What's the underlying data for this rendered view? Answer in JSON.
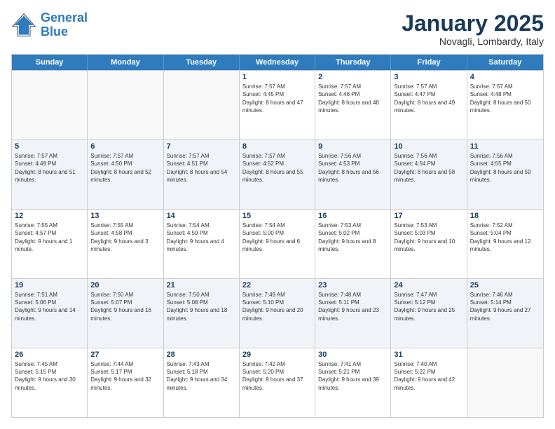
{
  "logo": {
    "line1": "General",
    "line2": "Blue"
  },
  "title": "January 2025",
  "subtitle": "Novagli, Lombardy, Italy",
  "days": [
    "Sunday",
    "Monday",
    "Tuesday",
    "Wednesday",
    "Thursday",
    "Friday",
    "Saturday"
  ],
  "weeks": [
    [
      {
        "day": "",
        "sunrise": "",
        "sunset": "",
        "daylight": ""
      },
      {
        "day": "",
        "sunrise": "",
        "sunset": "",
        "daylight": ""
      },
      {
        "day": "",
        "sunrise": "",
        "sunset": "",
        "daylight": ""
      },
      {
        "day": "1",
        "sunrise": "Sunrise: 7:57 AM",
        "sunset": "Sunset: 4:45 PM",
        "daylight": "Daylight: 8 hours and 47 minutes."
      },
      {
        "day": "2",
        "sunrise": "Sunrise: 7:57 AM",
        "sunset": "Sunset: 4:46 PM",
        "daylight": "Daylight: 8 hours and 48 minutes."
      },
      {
        "day": "3",
        "sunrise": "Sunrise: 7:57 AM",
        "sunset": "Sunset: 4:47 PM",
        "daylight": "Daylight: 8 hours and 49 minutes."
      },
      {
        "day": "4",
        "sunrise": "Sunrise: 7:57 AM",
        "sunset": "Sunset: 4:48 PM",
        "daylight": "Daylight: 8 hours and 50 minutes."
      }
    ],
    [
      {
        "day": "5",
        "sunrise": "Sunrise: 7:57 AM",
        "sunset": "Sunset: 4:49 PM",
        "daylight": "Daylight: 8 hours and 51 minutes."
      },
      {
        "day": "6",
        "sunrise": "Sunrise: 7:57 AM",
        "sunset": "Sunset: 4:50 PM",
        "daylight": "Daylight: 8 hours and 52 minutes."
      },
      {
        "day": "7",
        "sunrise": "Sunrise: 7:57 AM",
        "sunset": "Sunset: 4:51 PM",
        "daylight": "Daylight: 8 hours and 54 minutes."
      },
      {
        "day": "8",
        "sunrise": "Sunrise: 7:57 AM",
        "sunset": "Sunset: 4:52 PM",
        "daylight": "Daylight: 8 hours and 55 minutes."
      },
      {
        "day": "9",
        "sunrise": "Sunrise: 7:56 AM",
        "sunset": "Sunset: 4:53 PM",
        "daylight": "Daylight: 8 hours and 56 minutes."
      },
      {
        "day": "10",
        "sunrise": "Sunrise: 7:56 AM",
        "sunset": "Sunset: 4:54 PM",
        "daylight": "Daylight: 8 hours and 58 minutes."
      },
      {
        "day": "11",
        "sunrise": "Sunrise: 7:56 AM",
        "sunset": "Sunset: 4:55 PM",
        "daylight": "Daylight: 8 hours and 59 minutes."
      }
    ],
    [
      {
        "day": "12",
        "sunrise": "Sunrise: 7:55 AM",
        "sunset": "Sunset: 4:57 PM",
        "daylight": "Daylight: 9 hours and 1 minute."
      },
      {
        "day": "13",
        "sunrise": "Sunrise: 7:55 AM",
        "sunset": "Sunset: 4:58 PM",
        "daylight": "Daylight: 9 hours and 3 minutes."
      },
      {
        "day": "14",
        "sunrise": "Sunrise: 7:54 AM",
        "sunset": "Sunset: 4:59 PM",
        "daylight": "Daylight: 9 hours and 4 minutes."
      },
      {
        "day": "15",
        "sunrise": "Sunrise: 7:54 AM",
        "sunset": "Sunset: 5:00 PM",
        "daylight": "Daylight: 9 hours and 6 minutes."
      },
      {
        "day": "16",
        "sunrise": "Sunrise: 7:53 AM",
        "sunset": "Sunset: 5:02 PM",
        "daylight": "Daylight: 9 hours and 8 minutes."
      },
      {
        "day": "17",
        "sunrise": "Sunrise: 7:53 AM",
        "sunset": "Sunset: 5:03 PM",
        "daylight": "Daylight: 9 hours and 10 minutes."
      },
      {
        "day": "18",
        "sunrise": "Sunrise: 7:52 AM",
        "sunset": "Sunset: 5:04 PM",
        "daylight": "Daylight: 9 hours and 12 minutes."
      }
    ],
    [
      {
        "day": "19",
        "sunrise": "Sunrise: 7:51 AM",
        "sunset": "Sunset: 5:06 PM",
        "daylight": "Daylight: 9 hours and 14 minutes."
      },
      {
        "day": "20",
        "sunrise": "Sunrise: 7:50 AM",
        "sunset": "Sunset: 5:07 PM",
        "daylight": "Daylight: 9 hours and 16 minutes."
      },
      {
        "day": "21",
        "sunrise": "Sunrise: 7:50 AM",
        "sunset": "Sunset: 5:08 PM",
        "daylight": "Daylight: 9 hours and 18 minutes."
      },
      {
        "day": "22",
        "sunrise": "Sunrise: 7:49 AM",
        "sunset": "Sunset: 5:10 PM",
        "daylight": "Daylight: 9 hours and 20 minutes."
      },
      {
        "day": "23",
        "sunrise": "Sunrise: 7:48 AM",
        "sunset": "Sunset: 5:11 PM",
        "daylight": "Daylight: 9 hours and 23 minutes."
      },
      {
        "day": "24",
        "sunrise": "Sunrise: 7:47 AM",
        "sunset": "Sunset: 5:12 PM",
        "daylight": "Daylight: 9 hours and 25 minutes."
      },
      {
        "day": "25",
        "sunrise": "Sunrise: 7:46 AM",
        "sunset": "Sunset: 5:14 PM",
        "daylight": "Daylight: 9 hours and 27 minutes."
      }
    ],
    [
      {
        "day": "26",
        "sunrise": "Sunrise: 7:45 AM",
        "sunset": "Sunset: 5:15 PM",
        "daylight": "Daylight: 9 hours and 30 minutes."
      },
      {
        "day": "27",
        "sunrise": "Sunrise: 7:44 AM",
        "sunset": "Sunset: 5:17 PM",
        "daylight": "Daylight: 9 hours and 32 minutes."
      },
      {
        "day": "28",
        "sunrise": "Sunrise: 7:43 AM",
        "sunset": "Sunset: 5:18 PM",
        "daylight": "Daylight: 9 hours and 34 minutes."
      },
      {
        "day": "29",
        "sunrise": "Sunrise: 7:42 AM",
        "sunset": "Sunset: 5:20 PM",
        "daylight": "Daylight: 9 hours and 37 minutes."
      },
      {
        "day": "30",
        "sunrise": "Sunrise: 7:41 AM",
        "sunset": "Sunset: 5:21 PM",
        "daylight": "Daylight: 9 hours and 39 minutes."
      },
      {
        "day": "31",
        "sunrise": "Sunrise: 7:40 AM",
        "sunset": "Sunset: 5:22 PM",
        "daylight": "Daylight: 9 hours and 42 minutes."
      },
      {
        "day": "",
        "sunrise": "",
        "sunset": "",
        "daylight": ""
      }
    ]
  ]
}
